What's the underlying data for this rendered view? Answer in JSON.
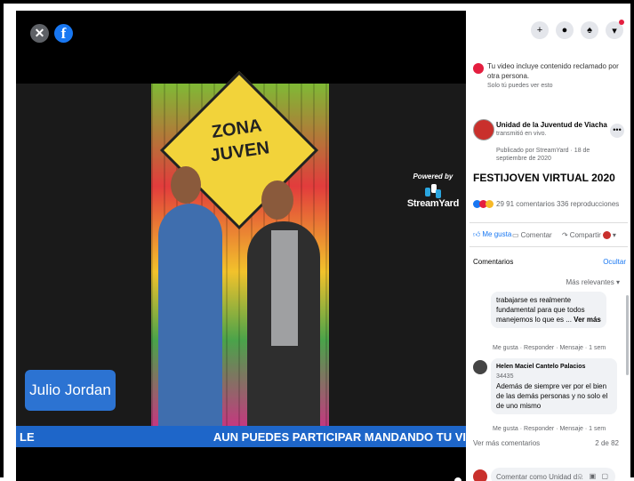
{
  "video": {
    "powered_by": "Powered by",
    "streamyard": "StreamYard",
    "sign_text": "ZONA JUVEN",
    "name_tag": "Julio Jordan",
    "ticker_left": "LE",
    "ticker_right": "AUN PUEDES PARTICIPAR MANDANDO TU VI"
  },
  "panel": {
    "claim_text": "Tu video incluye contenido reclamado por otra persona.",
    "claim_sub": "Solo tú puedes ver esto",
    "page_name": "Unidad de la Juventud de Viacha",
    "post_meta1": "transmitió en vivo.",
    "post_meta2": "Publicado por StreamYard · 18 de septiembre de 2020",
    "post_title": "FESTIJOVEN VIRTUAL 2020",
    "stats": "29  91 comentarios  336 reproducciones",
    "like_label": "Me gusta",
    "comment_label": "Comentar",
    "share_label": "Compartir",
    "comments_header": "Comentarios",
    "hide_label": "Ocultar",
    "sort_label": "Más relevantes",
    "c1_text": "trabajarse es realmente fundamental para que todos manejemos lo que es ...",
    "c1_more": "Ver más",
    "c1_meta": "Me gusta · Responder · Mensaje · 1 sem",
    "c2_author": "Helen Maciel Cantelo Palacios",
    "c2_sub": "34435",
    "c2_text": "Además de siempre ver por el bien de las demás personas y no solo el de uno mismo",
    "c2_meta": "Me gusta · Responder · Mensaje · 1 sem",
    "more_comments": "Ver más comentarios",
    "more_count": "2 de 82",
    "compose_placeholder": "Comentar como Unidad d..."
  },
  "colors": {
    "accent": "#1877f2",
    "ticker": "#1e66c9",
    "name_tag": "#2c73d2"
  }
}
